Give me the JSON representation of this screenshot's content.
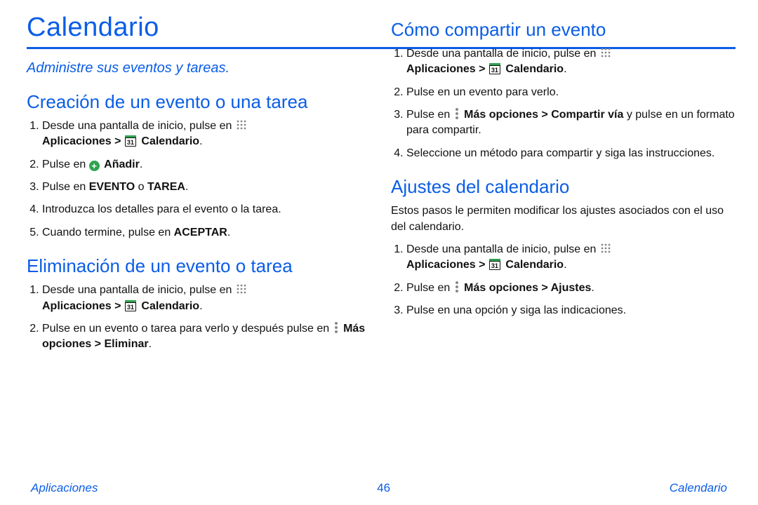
{
  "page_title": "Calendario",
  "subtitle": "Administre sus eventos y tareas.",
  "icons": {
    "calendar_num": "31",
    "plus_glyph": "+"
  },
  "left": {
    "create": {
      "heading": "Creación de un evento o una tarea",
      "steps": {
        "s1a": "Desde una pantalla de inicio, pulse en ",
        "s1b_apps": "Aplicaciones",
        "s1_gt": " > ",
        "s1c_cal": "Calendario",
        "period": ".",
        "s2a": "Pulse en ",
        "s2b_add": "Añadir",
        "s3a": "Pulse en ",
        "s3b_ev": "EVENTO",
        "s3c_or": " o ",
        "s3d_ta": "TAREA",
        "s4": "Introduzca los detalles para el evento o la tarea.",
        "s5a": "Cuando termine, pulse en ",
        "s5b_ok": "ACEPTAR"
      }
    },
    "delete": {
      "heading": "Eliminación de un evento o tarea",
      "steps": {
        "s1a": "Desde una pantalla de inicio, pulse en ",
        "s1b_apps": "Aplicaciones",
        "s1_gt": " > ",
        "s1c_cal": "Calendario",
        "period": ".",
        "s2a": "Pulse en un evento o tarea para verlo y después pulse en ",
        "s2b_more": "Más opciones > Eliminar"
      }
    }
  },
  "right": {
    "share": {
      "heading": "Cómo compartir un evento",
      "steps": {
        "s1a": "Desde una pantalla de inicio, pulse en ",
        "s1b_apps": "Aplicaciones",
        "s1_gt": " > ",
        "s1c_cal": "Calendario",
        "period": ".",
        "s2": "Pulse en un evento para verlo.",
        "s3a": "Pulse en ",
        "s3b_more": "Más opciones > Compartir vía",
        "s3c": " y pulse en un formato para compartir.",
        "s4": "Seleccione un método para compartir y siga las instrucciones."
      }
    },
    "settings": {
      "heading": "Ajustes del calendario",
      "intro": "Estos pasos le permiten modificar los ajustes asociados con el uso del calendario.",
      "steps": {
        "s1a": "Desde una pantalla de inicio, pulse en ",
        "s1b_apps": "Aplicaciones",
        "s1_gt": " > ",
        "s1c_cal": "Calendario",
        "period": ".",
        "s2a": "Pulse en ",
        "s2b_more": "Más opciones > Ajustes",
        "s3": "Pulse en una opción y siga las indicaciones."
      }
    }
  },
  "footer": {
    "left": "Aplicaciones",
    "center": "46",
    "right": "Calendario"
  }
}
